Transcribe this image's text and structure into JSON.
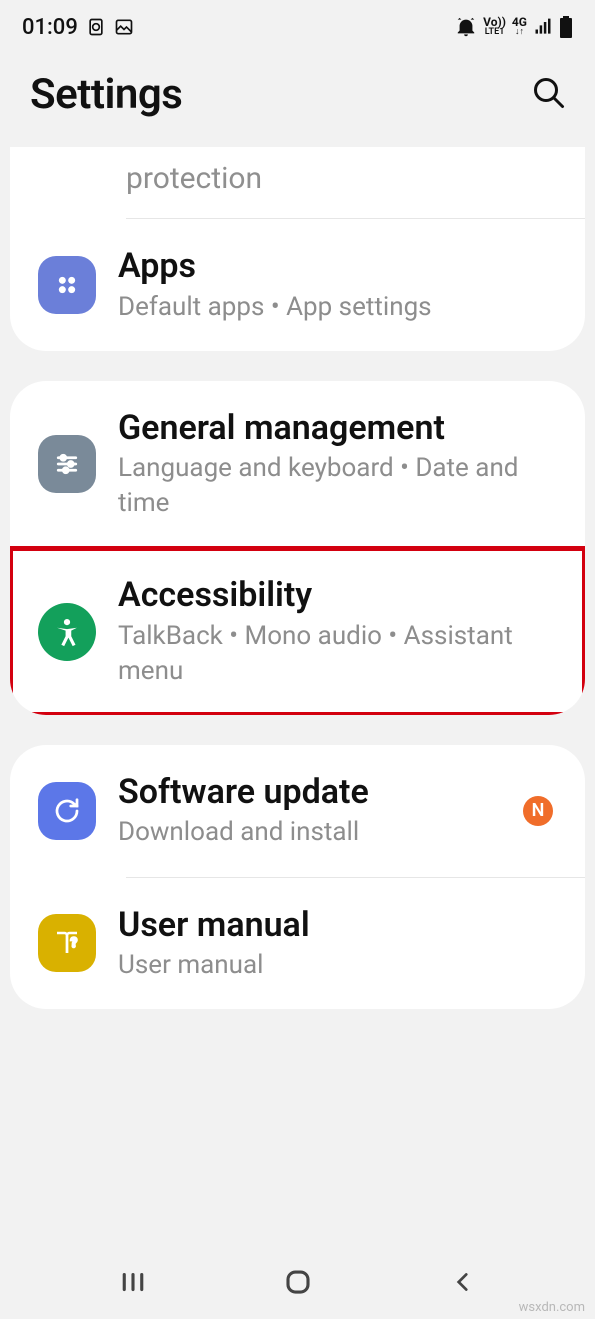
{
  "status": {
    "time": "01:09",
    "volte": "Vo))",
    "lte": "LTE1",
    "net": "4G"
  },
  "header": {
    "title": "Settings"
  },
  "partial_item": {
    "subtitle": "protection"
  },
  "items": {
    "apps": {
      "title": "Apps",
      "subtitle": "Default apps  •  App settings"
    },
    "general": {
      "title": "General management",
      "subtitle": "Language and keyboard  •  Date and time"
    },
    "accessibility": {
      "title": "Accessibility",
      "subtitle": "TalkBack  •  Mono audio  •  Assistant menu"
    },
    "software": {
      "title": "Software update",
      "subtitle": "Download and install",
      "badge": "N"
    },
    "manual": {
      "title": "User manual",
      "subtitle": "User manual"
    }
  },
  "watermark": "wsxdn.com"
}
